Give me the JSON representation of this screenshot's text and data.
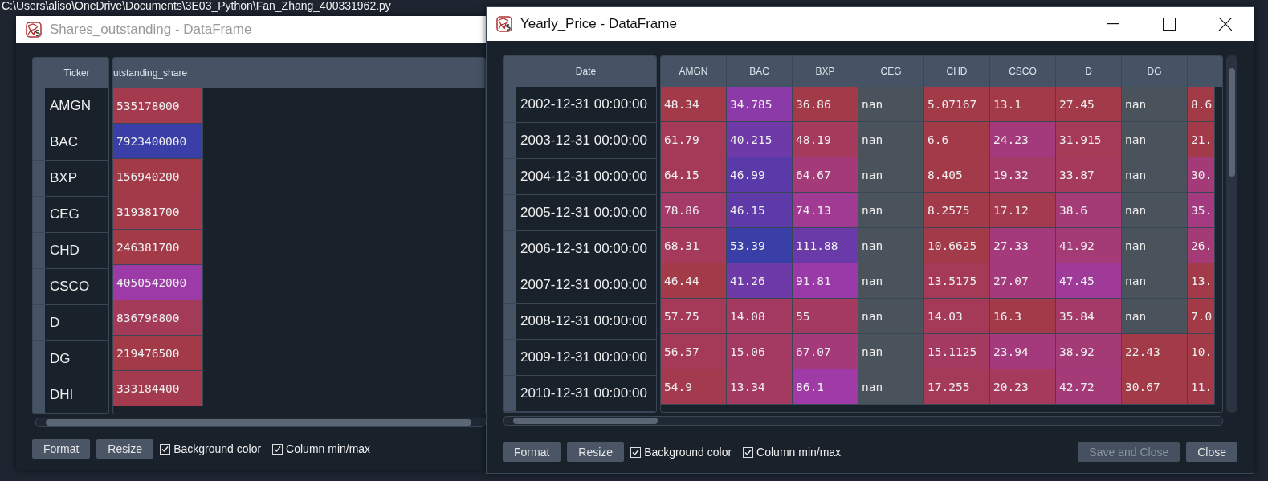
{
  "editor": {
    "path": "C:\\Users\\aliso\\OneDrive\\Documents\\3E03_Python\\Fan_Zhang_400331962.py"
  },
  "windows": [
    {
      "title": "Shares_outstanding - DataFrame",
      "active": false,
      "index_header": "Ticker",
      "columns": [
        "utstanding_share"
      ],
      "rows": [
        {
          "index": "AMGN",
          "cells": [
            {
              "text": "535178000",
              "color": "#a33a4e"
            }
          ]
        },
        {
          "index": "BAC",
          "cells": [
            {
              "text": "7923400000",
              "color": "#3a3fa8"
            }
          ]
        },
        {
          "index": "BXP",
          "cells": [
            {
              "text": "156940200",
              "color": "#a33a48"
            }
          ]
        },
        {
          "index": "CEG",
          "cells": [
            {
              "text": "319381700",
              "color": "#a33a4a"
            }
          ]
        },
        {
          "index": "CHD",
          "cells": [
            {
              "text": "246381700",
              "color": "#a33a48"
            }
          ]
        },
        {
          "index": "CSCO",
          "cells": [
            {
              "text": "4050542000",
              "color": "#9c3aa8"
            }
          ]
        },
        {
          "index": "D",
          "cells": [
            {
              "text": "836796800",
              "color": "#a33a58"
            }
          ]
        },
        {
          "index": "DG",
          "cells": [
            {
              "text": "219476500",
              "color": "#a33a48"
            }
          ]
        },
        {
          "index": "DHI",
          "cells": [
            {
              "text": "333184400",
              "color": "#a33a4e"
            }
          ]
        }
      ],
      "buttons": [
        {
          "label": "Format",
          "disabled": false
        },
        {
          "label": "Resize",
          "disabled": false
        }
      ],
      "checkboxes": [
        {
          "label": "Background color",
          "checked": true
        },
        {
          "label": "Column min/max",
          "checked": true
        }
      ]
    },
    {
      "title": "Yearly_Price - DataFrame",
      "active": true,
      "index_header": "Date",
      "columns": [
        "AMGN",
        "BAC",
        "BXP",
        "CEG",
        "CHD",
        "CSCO",
        "D",
        "DG"
      ],
      "rows": [
        {
          "index": "2002-12-31 00:00:00",
          "cells": [
            {
              "text": "48.34",
              "color": "#a33a4a"
            },
            {
              "text": "34.785",
              "color": "#8c3aa8"
            },
            {
              "text": "36.86",
              "color": "#a33a48"
            },
            {
              "text": "nan",
              "color": "#4a525c"
            },
            {
              "text": "5.07167",
              "color": "#a33a48"
            },
            {
              "text": "13.1",
              "color": "#a33a48"
            },
            {
              "text": "27.45",
              "color": "#a33a4a"
            },
            {
              "text": "nan",
              "color": "#4a525c"
            },
            {
              "text": "8.6",
              "color": "#a33a48"
            }
          ]
        },
        {
          "index": "2003-12-31 00:00:00",
          "cells": [
            {
              "text": "61.79",
              "color": "#a53a58"
            },
            {
              "text": "40.215",
              "color": "#6e3aa8"
            },
            {
              "text": "48.19",
              "color": "#a53a5c"
            },
            {
              "text": "nan",
              "color": "#4a525c"
            },
            {
              "text": "6.6",
              "color": "#a33a48"
            },
            {
              "text": "24.23",
              "color": "#a43a7c"
            },
            {
              "text": "31.915",
              "color": "#a53a58"
            },
            {
              "text": "nan",
              "color": "#4a525c"
            },
            {
              "text": "21.",
              "color": "#a33a4a"
            }
          ]
        },
        {
          "index": "2004-12-31 00:00:00",
          "cells": [
            {
              "text": "64.15",
              "color": "#a53a58"
            },
            {
              "text": "46.99",
              "color": "#5a3aa8"
            },
            {
              "text": "64.67",
              "color": "#a43a78"
            },
            {
              "text": "nan",
              "color": "#4a525c"
            },
            {
              "text": "8.405",
              "color": "#a33a4a"
            },
            {
              "text": "19.32",
              "color": "#a43a68"
            },
            {
              "text": "33.87",
              "color": "#a53a5c"
            },
            {
              "text": "nan",
              "color": "#4a525c"
            },
            {
              "text": "30.",
              "color": "#a43a78"
            }
          ]
        },
        {
          "index": "2005-12-31 00:00:00",
          "cells": [
            {
              "text": "78.86",
              "color": "#a43a68"
            },
            {
              "text": "46.15",
              "color": "#5e3aa8"
            },
            {
              "text": "74.13",
              "color": "#a03a92"
            },
            {
              "text": "nan",
              "color": "#4a525c"
            },
            {
              "text": "8.2575",
              "color": "#a33a4a"
            },
            {
              "text": "17.12",
              "color": "#a33a4e"
            },
            {
              "text": "38.6",
              "color": "#a43a76"
            },
            {
              "text": "nan",
              "color": "#4a525c"
            },
            {
              "text": "35.",
              "color": "#a43a80"
            }
          ]
        },
        {
          "index": "2006-12-31 00:00:00",
          "cells": [
            {
              "text": "68.31",
              "color": "#a53a5c"
            },
            {
              "text": "53.39",
              "color": "#3a3fa8"
            },
            {
              "text": "111.88",
              "color": "#6a3aa8"
            },
            {
              "text": "nan",
              "color": "#4a525c"
            },
            {
              "text": "10.6625",
              "color": "#a33a4a"
            },
            {
              "text": "27.33",
              "color": "#a43a7c"
            },
            {
              "text": "41.92",
              "color": "#a43a76"
            },
            {
              "text": "nan",
              "color": "#4a525c"
            },
            {
              "text": "26.",
              "color": "#a43a76"
            }
          ]
        },
        {
          "index": "2007-12-31 00:00:00",
          "cells": [
            {
              "text": "46.44",
              "color": "#a33a48"
            },
            {
              "text": "41.26",
              "color": "#6e3aa8"
            },
            {
              "text": "91.81",
              "color": "#9a3aa8"
            },
            {
              "text": "nan",
              "color": "#4a525c"
            },
            {
              "text": "13.5175",
              "color": "#a53a58"
            },
            {
              "text": "27.07",
              "color": "#a43a7c"
            },
            {
              "text": "47.45",
              "color": "#a03a98"
            },
            {
              "text": "nan",
              "color": "#4a525c"
            },
            {
              "text": "13.",
              "color": "#a33a4a"
            }
          ]
        },
        {
          "index": "2008-12-31 00:00:00",
          "cells": [
            {
              "text": "57.75",
              "color": "#a53a58"
            },
            {
              "text": "14.08",
              "color": "#a43a60"
            },
            {
              "text": "55",
              "color": "#a43a60"
            },
            {
              "text": "nan",
              "color": "#4a525c"
            },
            {
              "text": "14.03",
              "color": "#a53a58"
            },
            {
              "text": "16.3",
              "color": "#a33a4a"
            },
            {
              "text": "35.84",
              "color": "#a43a68"
            },
            {
              "text": "nan",
              "color": "#4a525c"
            },
            {
              "text": "7.0",
              "color": "#a33a48"
            }
          ]
        },
        {
          "index": "2009-12-31 00:00:00",
          "cells": [
            {
              "text": "56.57",
              "color": "#a53a58"
            },
            {
              "text": "15.06",
              "color": "#a43a62"
            },
            {
              "text": "67.07",
              "color": "#a43a7a"
            },
            {
              "text": "nan",
              "color": "#4a525c"
            },
            {
              "text": "15.1125",
              "color": "#a43a60"
            },
            {
              "text": "23.94",
              "color": "#a43a7c"
            },
            {
              "text": "38.92",
              "color": "#a43a76"
            },
            {
              "text": "22.43",
              "color": "#a33a48"
            },
            {
              "text": "10.",
              "color": "#a33a48"
            }
          ]
        },
        {
          "index": "2010-12-31 00:00:00",
          "cells": [
            {
              "text": "54.9",
              "color": "#a33a4e"
            },
            {
              "text": "13.34",
              "color": "#a43a60"
            },
            {
              "text": "86.1",
              "color": "#a03aa6"
            },
            {
              "text": "nan",
              "color": "#4a525c"
            },
            {
              "text": "17.255",
              "color": "#a53a58"
            },
            {
              "text": "20.23",
              "color": "#a53a5c"
            },
            {
              "text": "42.72",
              "color": "#a43a78"
            },
            {
              "text": "30.67",
              "color": "#a33a48"
            },
            {
              "text": "11.",
              "color": "#a33a4a"
            }
          ]
        }
      ],
      "buttons": [
        {
          "label": "Format",
          "disabled": false
        },
        {
          "label": "Resize",
          "disabled": false
        }
      ],
      "checkboxes": [
        {
          "label": "Background color",
          "checked": true
        },
        {
          "label": "Column min/max",
          "checked": true
        }
      ],
      "actions": [
        {
          "label": "Save and Close",
          "disabled": true
        },
        {
          "label": "Close",
          "disabled": false
        }
      ]
    }
  ]
}
